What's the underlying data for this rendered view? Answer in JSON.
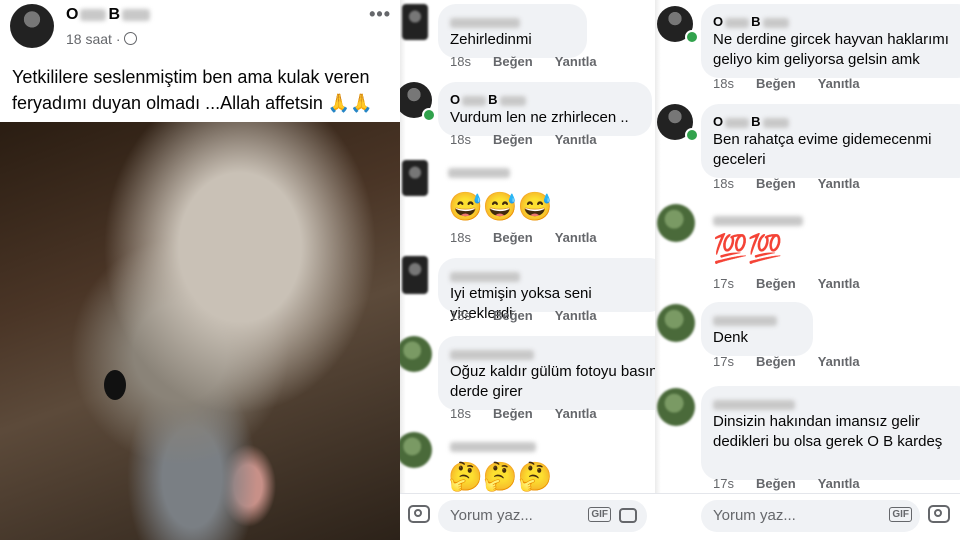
{
  "post": {
    "author": "O",
    "author_suffix": "B",
    "time": "18 saat",
    "text": "Yetkililere seslenmiştim ben ama kulak veren feryadımı duyan olmadı ...Allah affetsin 🙏🙏"
  },
  "column1": [
    {
      "name_blurred": true,
      "text": "Zehirledinmi",
      "age": "18s",
      "like": "Beğen",
      "reply": "Yanıtla",
      "avatar": "dark"
    },
    {
      "name": "O",
      "name_suffix": "B",
      "text": "Vurdum len ne zrhirlecen ..",
      "age": "18s",
      "like": "Beğen",
      "reply": "Yanıtla",
      "avatar": "dark",
      "online": true
    },
    {
      "name_blurred": true,
      "emoji": "😅😅😅",
      "age": "18s",
      "like": "Beğen",
      "reply": "Yanıtla",
      "avatar": "dark"
    },
    {
      "name_blurred": true,
      "text": "Iyi etmişin yoksa seni yiceklerdi",
      "age": "18s",
      "like": "Beğen",
      "reply": "Yanıtla",
      "avatar": "dark"
    },
    {
      "name_blurred": true,
      "text": "Oğuz kaldır gülüm fotoyu basın derde girer",
      "age": "18s",
      "like": "Beğen",
      "reply": "Yanıtla",
      "avatar": "green"
    },
    {
      "name_blurred": true,
      "emoji": "🤔🤔🤔",
      "avatar": "green"
    }
  ],
  "column2": [
    {
      "name": "O",
      "name_suffix": "B",
      "text": "Ne derdine gircek hayvan haklarımı geliyo kim geliyorsa gelsin amk",
      "age": "18s",
      "like": "Beğen",
      "reply": "Yanıtla",
      "avatar": "dark",
      "online": true
    },
    {
      "name": "O",
      "name_suffix": "B",
      "text": "Ben rahatça evime gidemecenmi geceleri",
      "age": "18s",
      "like": "Beğen",
      "reply": "Yanıtla",
      "avatar": "dark",
      "online": true
    },
    {
      "name_blurred": true,
      "emoji": "💯💯",
      "age": "17s",
      "like": "Beğen",
      "reply": "Yanıtla",
      "avatar": "green"
    },
    {
      "name_blurred": true,
      "text": "Denk",
      "age": "17s",
      "like": "Beğen",
      "reply": "Yanıtla",
      "avatar": "green"
    },
    {
      "name_blurred": true,
      "text": "Dinsizin hakından imansız gelir dedikleri bu olsa gerek O B kardeş",
      "age": "17s",
      "like": "Beğen",
      "reply": "Yanıtla",
      "avatar": "green"
    }
  ],
  "composer": {
    "placeholder": "Yorum yaz...",
    "gif": "GIF"
  }
}
